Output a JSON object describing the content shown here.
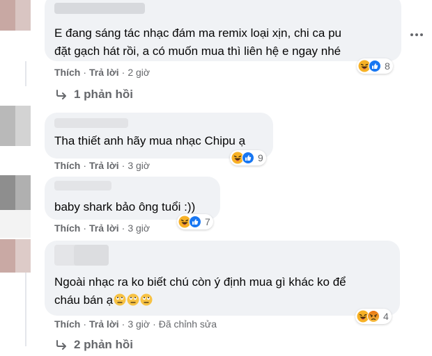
{
  "comments": [
    {
      "text_lines": [
        "E đang sáng tác nhạc đám ma remix loại xịn, chi ca pu",
        "đặt gạch hát rồi, a có muốn mua thì liên hệ e ngay nhé"
      ],
      "actions": {
        "like": "Thích",
        "reply": "Trả lời",
        "time": "2 giờ"
      },
      "reactions": {
        "icons": [
          "haha",
          "like"
        ],
        "count": "8"
      },
      "replies_label": "1 phản hồi"
    },
    {
      "text_lines": [
        "Tha thiết anh hãy mua nhạc Chipu ạ"
      ],
      "actions": {
        "like": "Thích",
        "reply": "Trả lời",
        "time": "3 giờ"
      },
      "reactions": {
        "icons": [
          "haha",
          "like"
        ],
        "count": "9"
      }
    },
    {
      "text_lines": [
        "baby shark bảo ông tuổi :))"
      ],
      "actions": {
        "like": "Thích",
        "reply": "Trả lời",
        "time": "3 giờ"
      },
      "reactions": {
        "icons": [
          "haha",
          "like"
        ],
        "count": "7"
      }
    },
    {
      "text_lines": [
        "Ngoài nhạc ra ko biết chú còn ý định mua gì khác ko để",
        "cháu bán ạ"
      ],
      "inline_emojis": [
        "rolling-eyes",
        "rolling-eyes",
        "rolling-eyes"
      ],
      "actions": {
        "like": "Thích",
        "reply": "Trả lời",
        "time": "3 giờ",
        "edited": "Đã chỉnh sửa"
      },
      "reactions": {
        "icons": [
          "haha",
          "angry"
        ],
        "count": "4"
      },
      "replies_label": "2 phản hồi"
    }
  ],
  "colors": {
    "bubble": "#f0f2f5",
    "secondary_text": "#65676b",
    "like_blue": "#1877f2",
    "haha_yellow": "#f7b125",
    "angry_orange": "#e9710f"
  }
}
